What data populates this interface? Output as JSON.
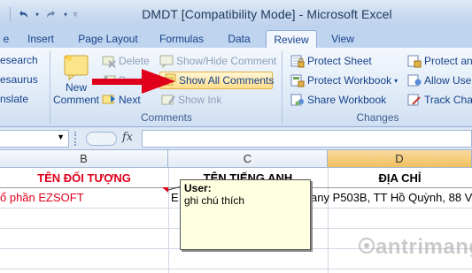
{
  "window": {
    "title": "DMDT  [Compatibility Mode] - Microsoft Excel"
  },
  "tabs": [
    {
      "label": "e",
      "active": false
    },
    {
      "label": "Insert",
      "active": false
    },
    {
      "label": "Page Layout",
      "active": false
    },
    {
      "label": "Formulas",
      "active": false
    },
    {
      "label": "Data",
      "active": false
    },
    {
      "label": "Review",
      "active": true
    },
    {
      "label": "View",
      "active": false
    }
  ],
  "ribbon": {
    "proofing": {
      "items": [
        "esearch",
        "esaurus",
        "nslate"
      ]
    },
    "comments": {
      "group_label": "Comments",
      "new_comment": [
        "New",
        "Comment"
      ],
      "delete": "Delete",
      "previous": "Previous",
      "next": "Next",
      "show_hide_comment": "Show/Hide Comment",
      "show_all_comments": "Show All Comments",
      "show_ink": "Show Ink"
    },
    "changes": {
      "group_label": "Changes",
      "protect_sheet": "Protect Sheet",
      "protect_workbook": "Protect Workbook",
      "share_workbook": "Share Workbook",
      "protect_and_share": "Protect and",
      "allow_users": "Allow User",
      "track_changes": "Track Chan"
    }
  },
  "formula_bar": {
    "fx_label": "fx",
    "value": ""
  },
  "columns": [
    {
      "label": "B",
      "selected": false
    },
    {
      "label": "C",
      "selected": false
    },
    {
      "label": "D",
      "selected": true
    }
  ],
  "rows": {
    "header": {
      "b": "TÊN ĐỐI TƯỢNG",
      "c": "TÊN TIẾNG ANH",
      "d": "ĐỊA CHỈ"
    },
    "row1": {
      "b": "ổ phần EZSOFT",
      "c": "E",
      "c_tail": "any P503B, TT Hồ Quỳnh, 88 V"
    }
  },
  "comment": {
    "author": "User:",
    "text": "ghi chú thích"
  },
  "watermark": "antrimang",
  "colors": {
    "accent_red": "#e0001b",
    "header_text": "#c00000",
    "selection": "#f1c15f"
  }
}
